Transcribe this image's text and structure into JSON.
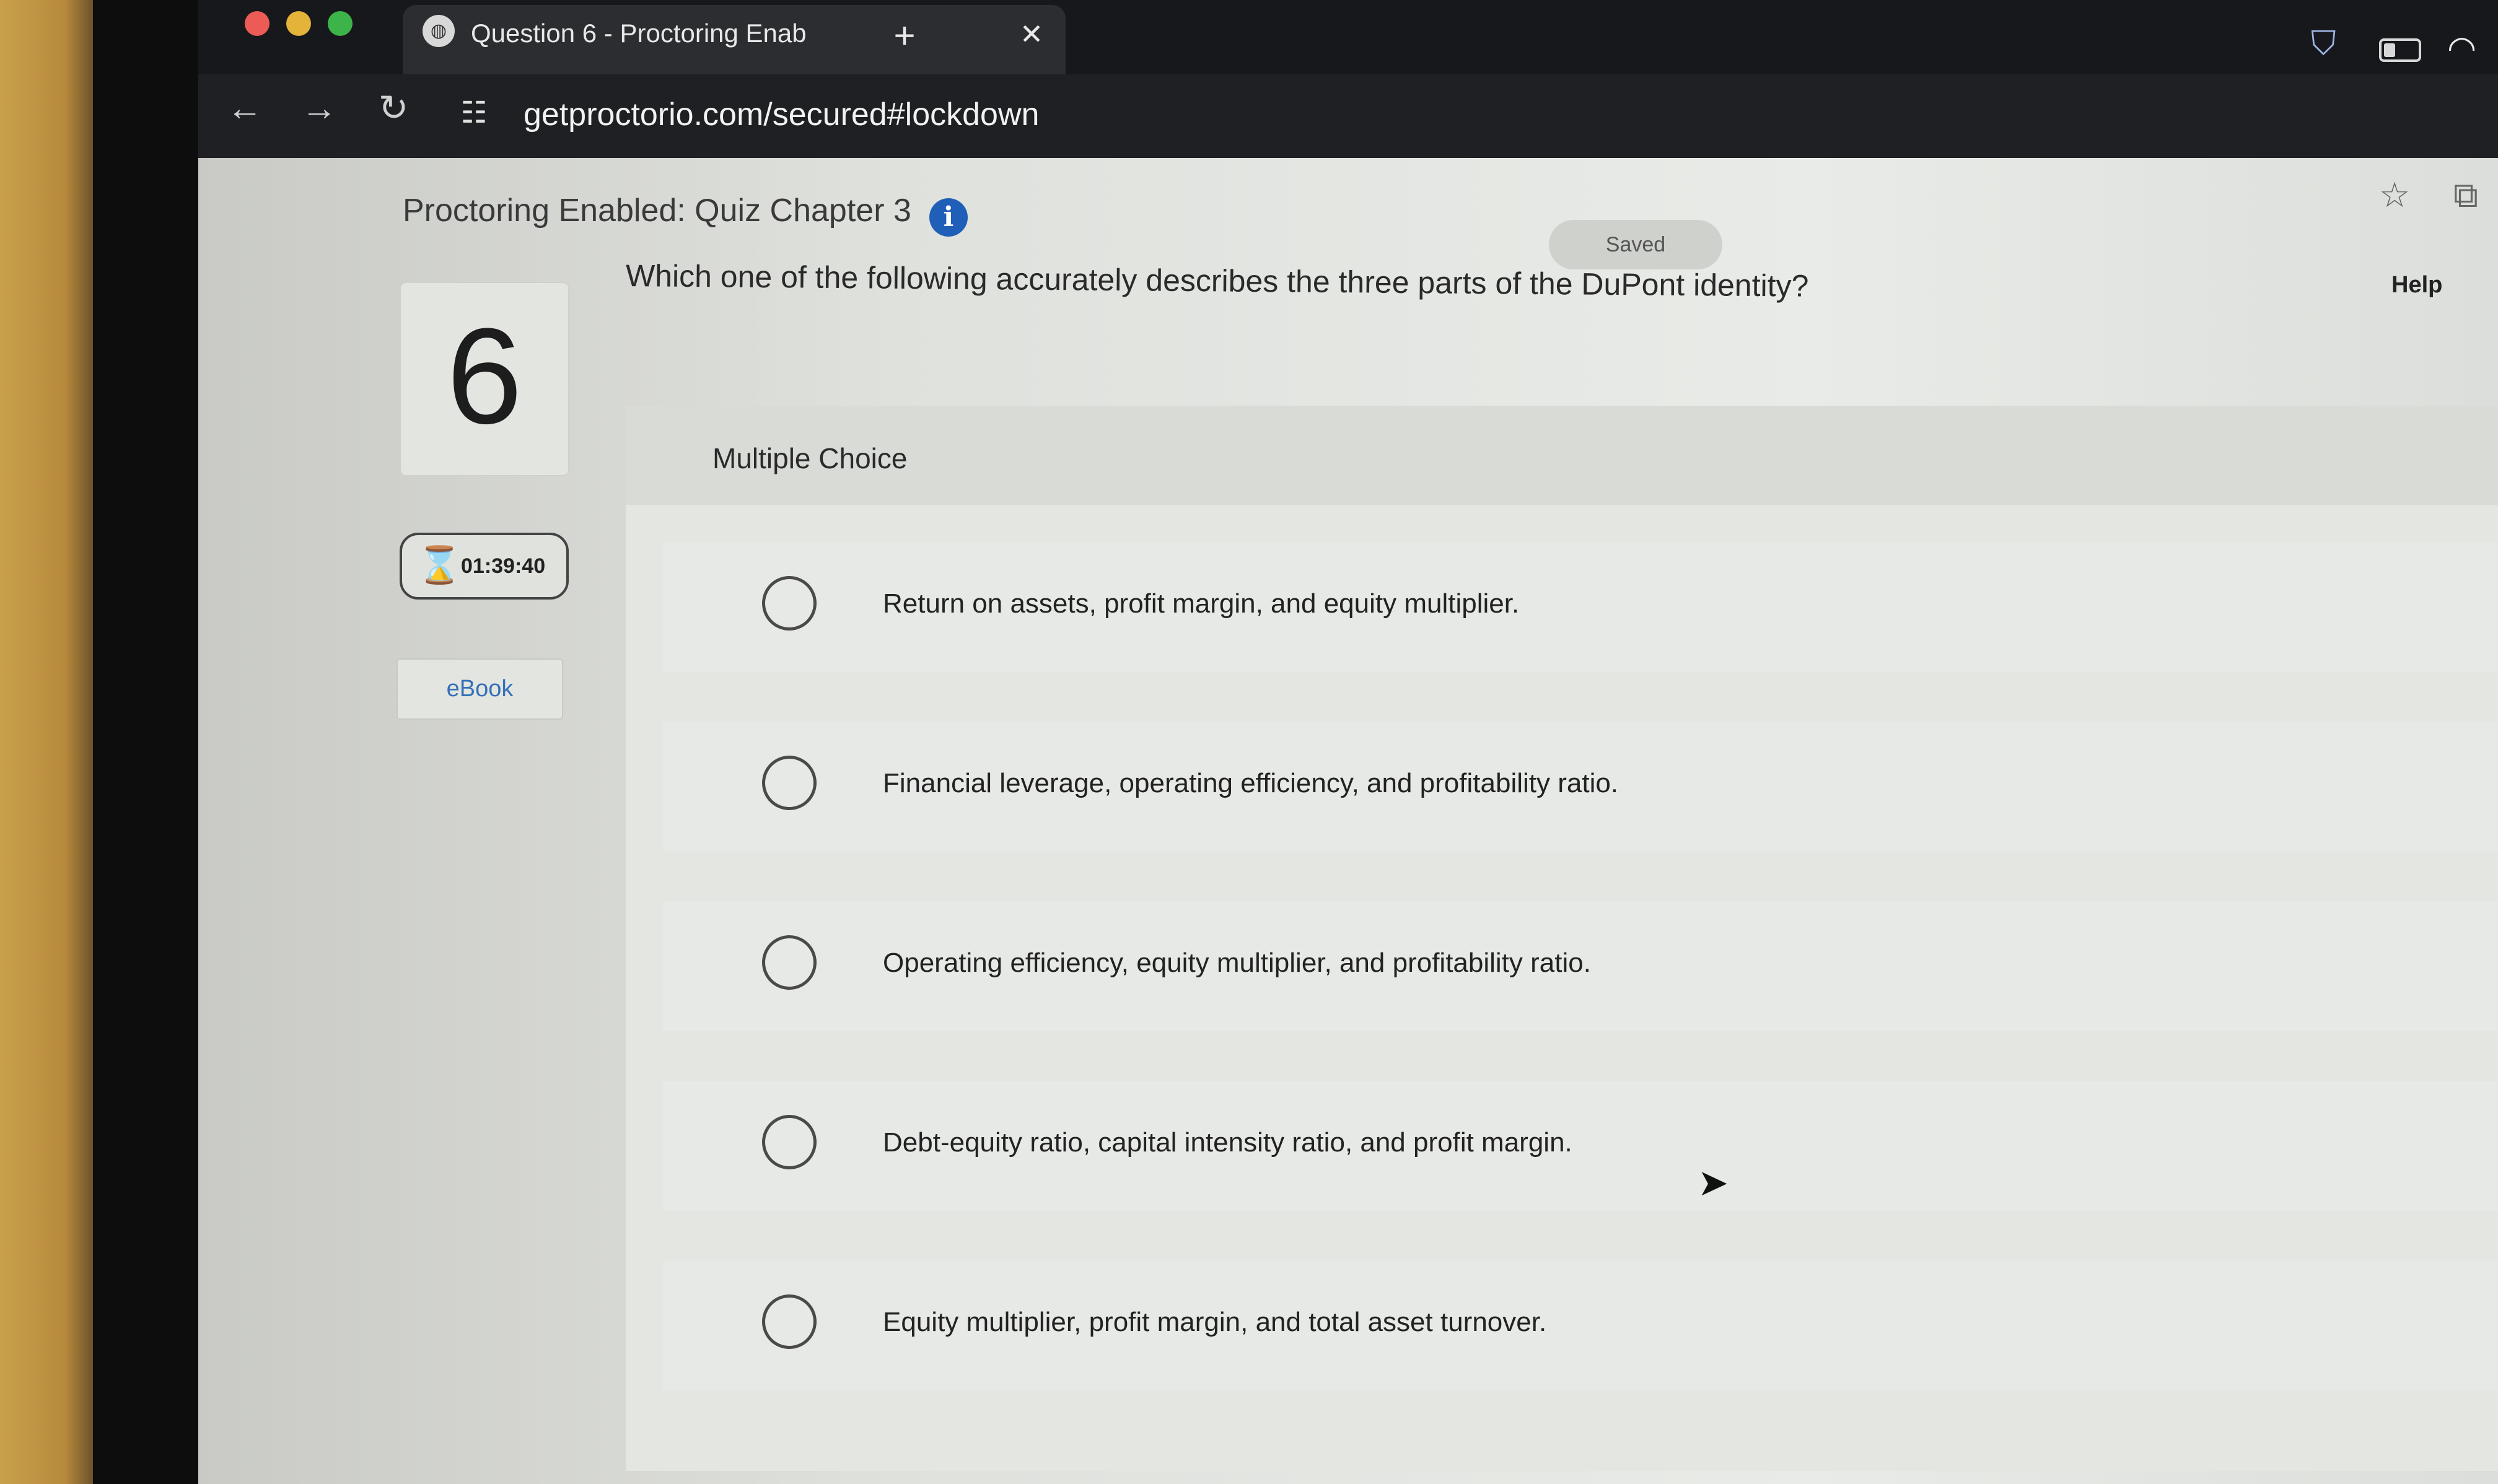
{
  "browser": {
    "tab_title": "Question 6 - Proctoring Enab",
    "tab_close": "✕",
    "new_tab": "+",
    "url": "getproctorio.com/secured#lockdown",
    "back": "←",
    "forward": "→",
    "reload": "↻",
    "site_info": "☷",
    "bookmark": "☆",
    "extensions": "⧉"
  },
  "header": {
    "quiz_title": "Proctoring Enabled: Quiz Chapter 3",
    "info_glyph": "i",
    "saved": "Saved",
    "help": "Help"
  },
  "sidebar": {
    "question_number": "6",
    "timer": "01:39:40",
    "timer_icon": "⌛",
    "ebook": "eBook"
  },
  "question": {
    "text": "Which one of the following accurately describes the three parts of the DuPont identity?",
    "type_label": "Multiple Choice",
    "options": [
      "Return on assets, profit margin, and equity multiplier.",
      "Financial leverage, operating efficiency, and profitability ratio.",
      "Operating efficiency, equity multiplier, and profitability ratio.",
      "Debt-equity ratio, capital intensity ratio, and profit margin.",
      "Equity multiplier, profit margin, and total asset turnover."
    ]
  },
  "colors": {
    "info_blue": "#1f5fb8",
    "ebook_link": "#3670b8"
  }
}
